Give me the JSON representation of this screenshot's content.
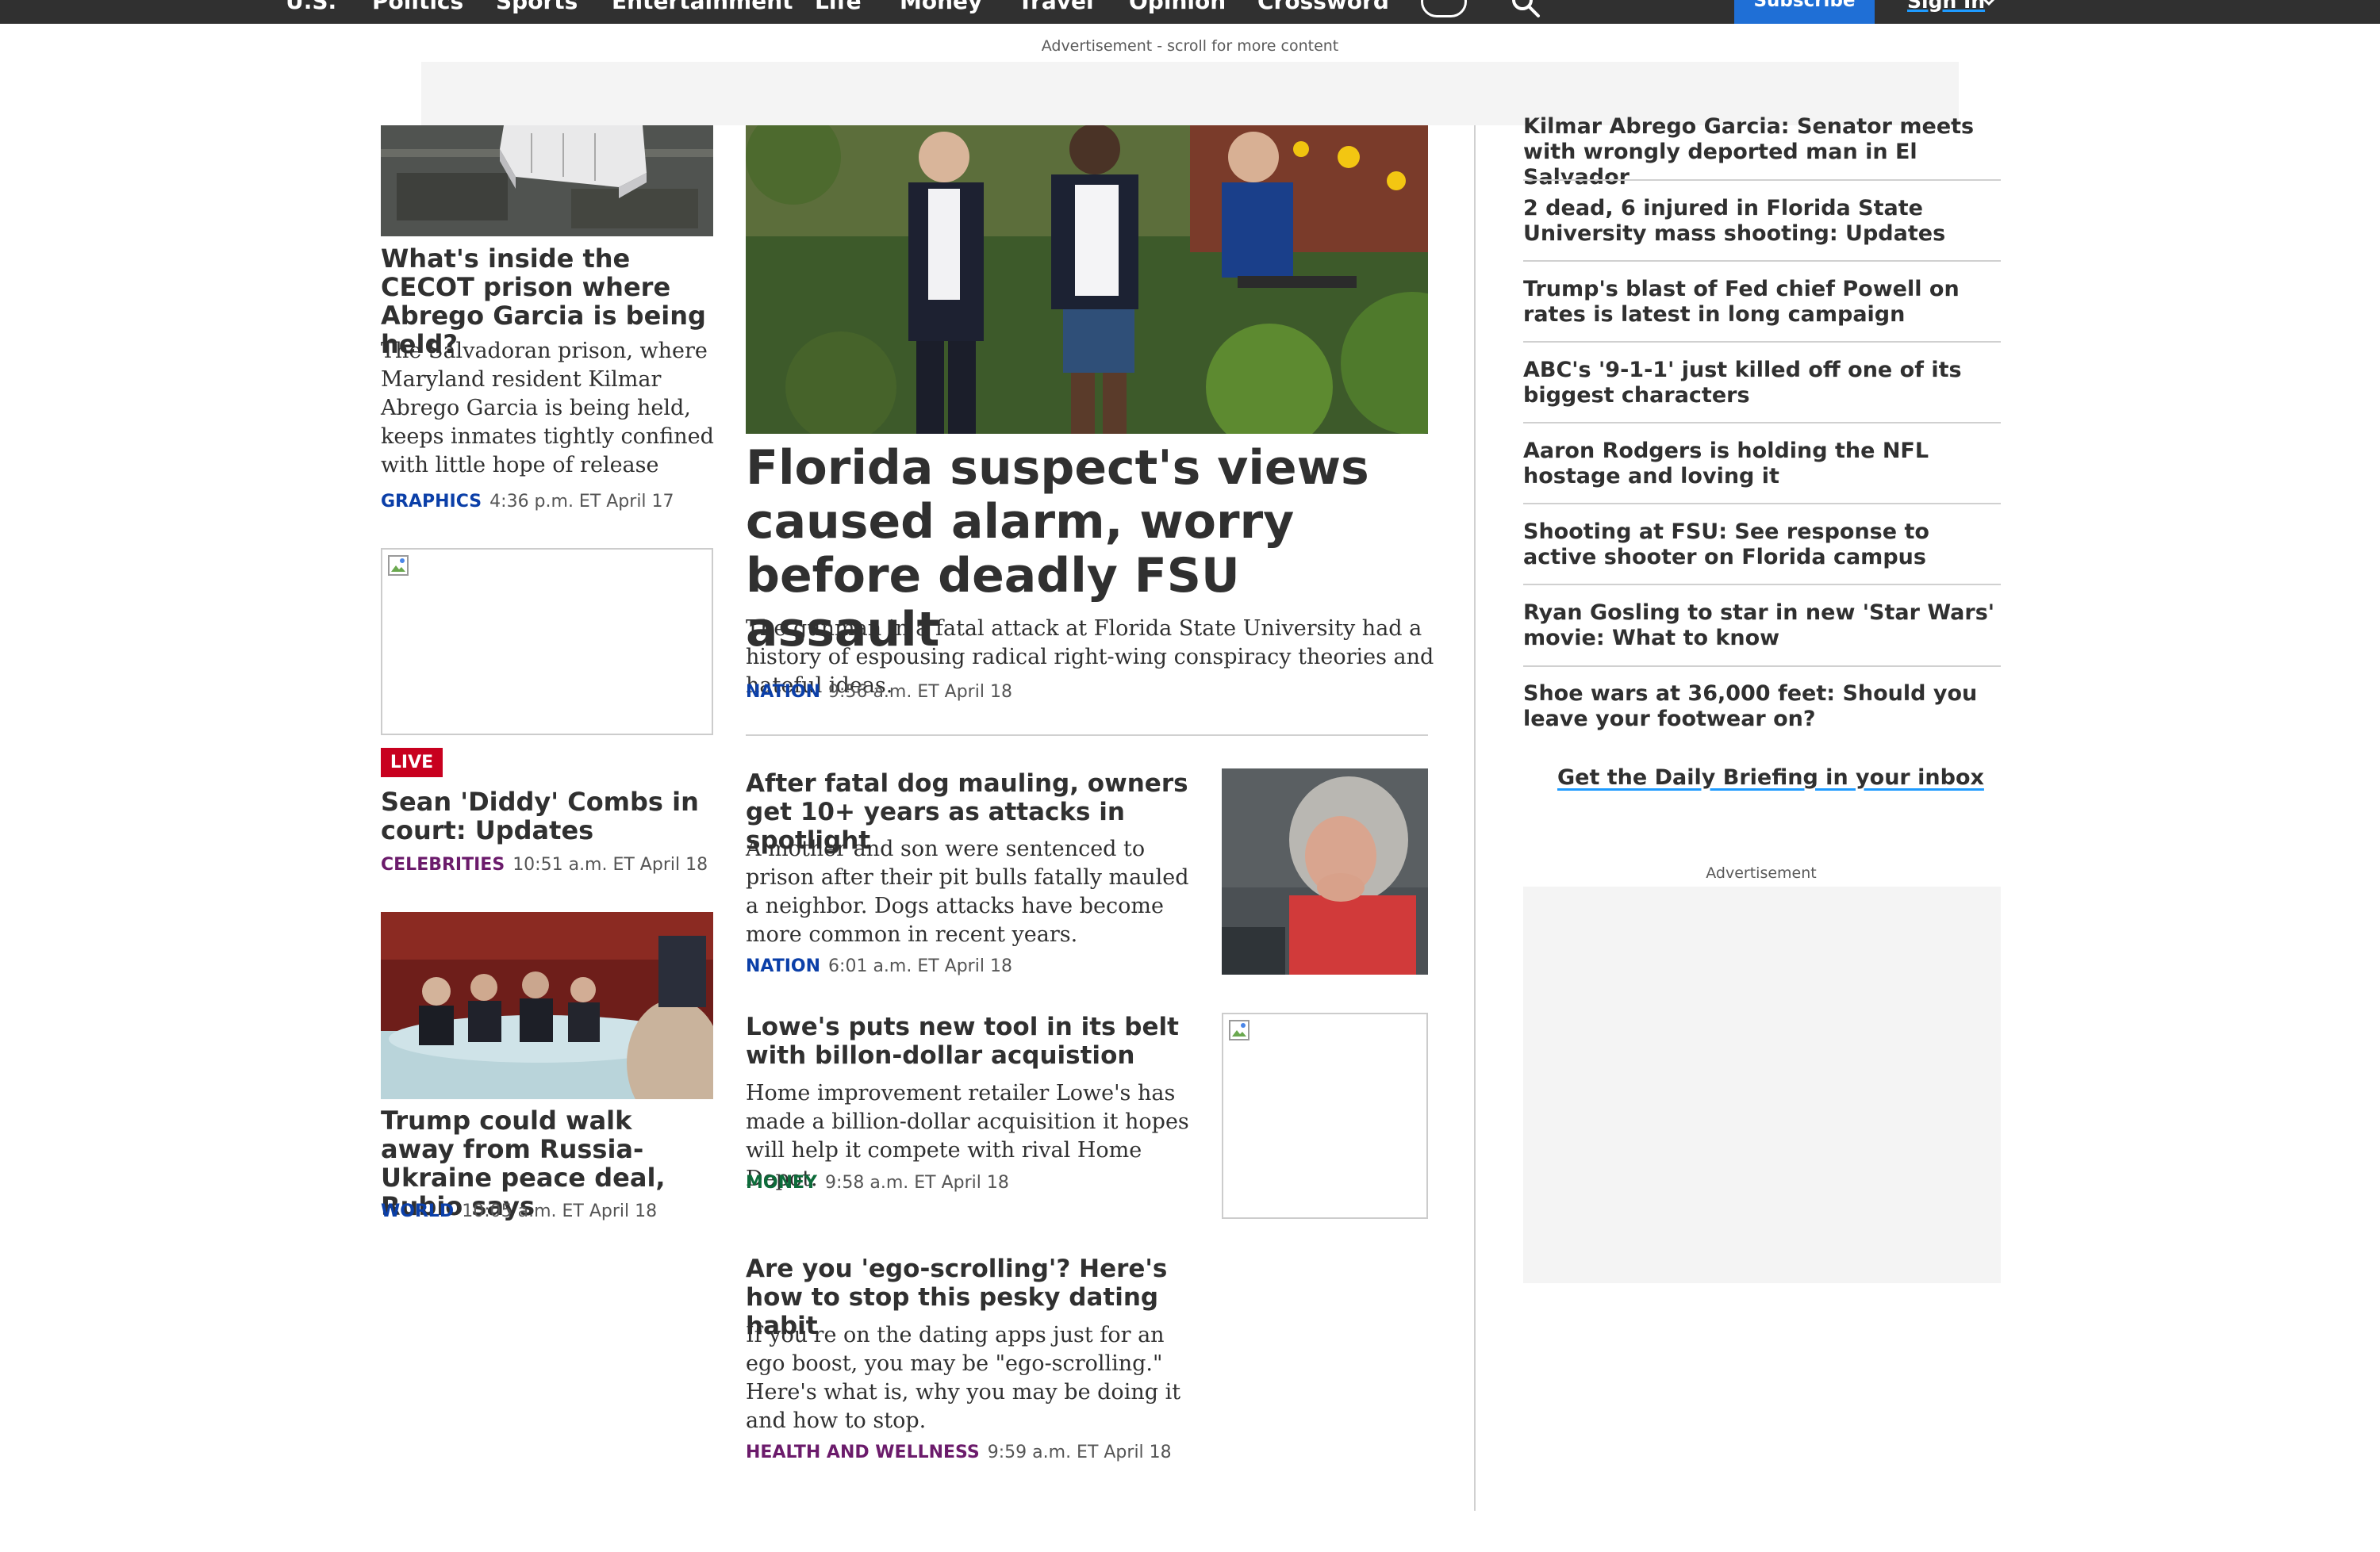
{
  "nav": {
    "items": [
      "U.S.",
      "Politics",
      "Sports",
      "Entertainment",
      "Life",
      "Money",
      "Travel",
      "Opinion",
      "Crossword"
    ],
    "subscribe": "Subscribe",
    "sign_in": "Sign In"
  },
  "ad_banner_label": "Advertisement - scroll for more content",
  "left_column": {
    "story1": {
      "title": "What's inside the CECOT prison where Abrego Garcia is being held?",
      "summary": "The Salvadoran prison, where Maryland resident Kilmar Abrego Garcia is being held, keeps inmates tightly confined with little hope of release",
      "category": "GRAPHICS",
      "time": "4:36 p.m. ET April 17"
    },
    "story2": {
      "badge": "LIVE",
      "title": "Sean 'Diddy' Combs in court: Updates",
      "category": "CELEBRITIES",
      "time": "10:51 a.m. ET April 18"
    },
    "story3": {
      "title": "Trump could walk away from Russia-Ukraine peace deal, Rubio says",
      "category": "WORLD",
      "time": "10:05 a.m. ET April 18"
    }
  },
  "main_story": {
    "title": "Florida suspect's views caused alarm, worry before deadly FSU assault",
    "summary": "The gunman in a fatal attack at Florida State University had a history of espousing radical right-wing conspiracy theories and hateful ideas.",
    "category": "NATION",
    "time": "9:56 a.m. ET April 18"
  },
  "center_stories": [
    {
      "title": "After fatal dog mauling, owners get 10+ years as attacks in spotlight",
      "summary": "A mother and son were sentenced to prison after their pit bulls fatally mauled a neighbor. Dogs attacks have become more common in recent years.",
      "category": "NATION",
      "time": "6:01 a.m. ET April 18"
    },
    {
      "title": "Lowe's puts new tool in its belt with billon-dollar acquistion",
      "summary": "Home improvement retailer Lowe's has made a billion-dollar acquisition it hopes will help it compete with rival Home Depot.",
      "category": "MONEY",
      "time": "9:58 a.m. ET April 18"
    },
    {
      "title": "Are you 'ego-scrolling'? Here's how to stop this pesky dating habit",
      "summary": "If you're on the dating apps just for an ego boost, you may be \"ego-scrolling.\" Here's what is, why you may be doing it and how to stop.",
      "category": "HEALTH AND WELLNESS",
      "time": "9:59 a.m. ET April 18"
    }
  ],
  "trending": [
    "Kilmar Abrego Garcia: Senator meets with wrongly deported man in El Salvador",
    "2 dead, 6 injured in Florida State University mass shooting: Updates",
    "Trump's blast of Fed chief Powell on rates is latest in long campaign",
    "ABC's '9-1-1' just killed off one of its biggest characters",
    "Aaron Rodgers is holding the NFL hostage and loving it",
    "Shooting at FSU: See response to active shooter on Florida campus",
    "Ryan Gosling to star in new 'Star Wars' movie: What to know",
    "Shoe wars at 36,000 feet: Should you leave your footwear on?"
  ],
  "newsletter_link": "Get the Daily Briefing in your inbox",
  "ad_side_label": "Advertisement",
  "colors": {
    "nav_bg": "#303030",
    "subscribe_bg": "#1f6fd6",
    "nation": "#0b3fa8",
    "money": "#0d6b3a",
    "celebrities": "#6b1b6b",
    "live": "#c8001f"
  }
}
